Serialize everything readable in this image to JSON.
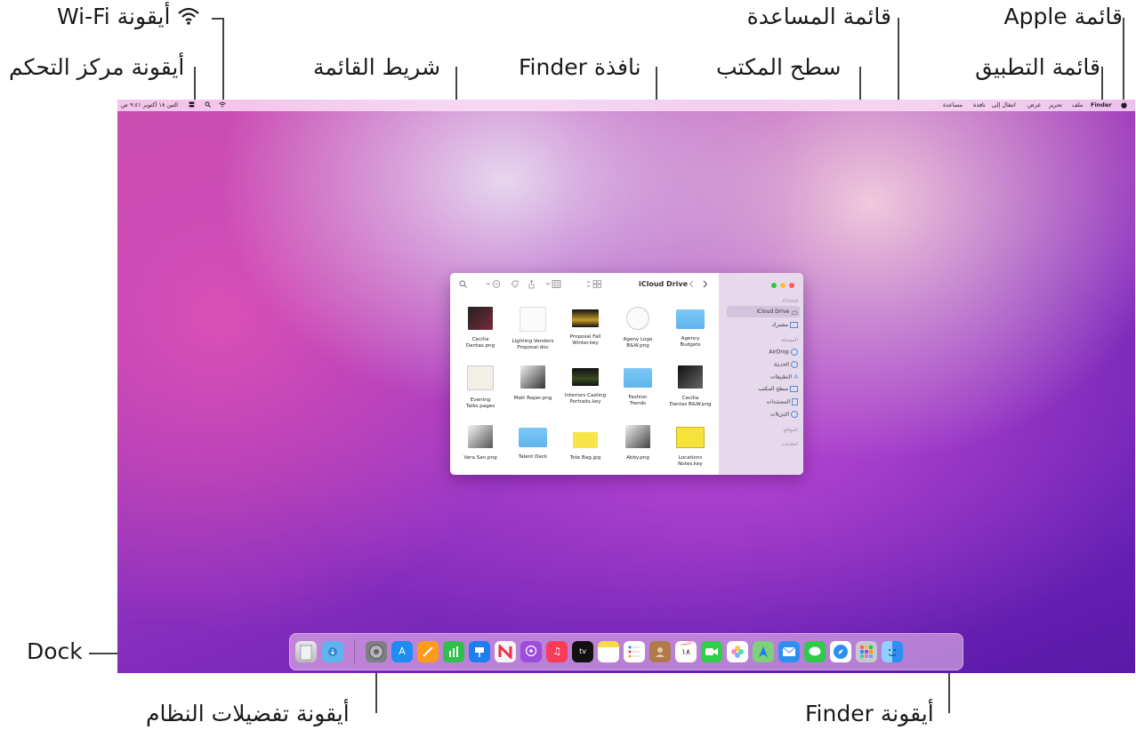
{
  "callouts": {
    "apple_menu": "قائمة Apple",
    "help_menu": "قائمة المساعدة",
    "wifi_icon": "أيقونة Wi-Fi",
    "control_center_icon": "أيقونة مركز التحكم",
    "menu_bar": "شريط القائمة",
    "finder_window": "نافذة Finder",
    "desktop": "سطح المكتب",
    "app_menu": "قائمة التطبيق",
    "dock": "Dock",
    "system_prefs_icon": "أيقونة تفضيلات النظام",
    "finder_icon": "أيقونة Finder"
  },
  "menubar": {
    "app_name": "Finder",
    "menus": [
      "ملف",
      "تحرير",
      "عرض",
      "انتقال إلى",
      "نافذة",
      "مساعدة"
    ],
    "clock": "الثين ١٨ أكتوبر ٩:٤١ ص"
  },
  "finder": {
    "title": "iCloud Drive",
    "sidebar": {
      "icloud_heading": "iCloud",
      "icloud_drive": "iCloud Drive",
      "shared": "مشترك",
      "favorites_heading": "المفضلة",
      "airdrop": "AirDrop",
      "recents": "الحديثة",
      "applications": "التطبيقات",
      "desktop": "سطح المكتب",
      "documents": "المستندات",
      "downloads": "التنزيلات",
      "locations_heading": "المواقع",
      "tags_heading": "العلامات"
    },
    "files": [
      {
        "line1": "Cecilia",
        "line2": "Dantas.png"
      },
      {
        "line1": "Lighting Vendors",
        "line2": "Proposal.doc"
      },
      {
        "line1": "Proposal Fall",
        "line2": "Winter.key"
      },
      {
        "line1": "Ageny Logo",
        "line2": "B&W.png"
      },
      {
        "line1": "Agency",
        "line2": "Budgets"
      },
      {
        "line1": "Evening",
        "line2": "Talks.pages"
      },
      {
        "line1": "Matt Roper.png",
        "line2": ""
      },
      {
        "line1": "Interiors Casting",
        "line2": "Portraits.key"
      },
      {
        "line1": "Fashion",
        "line2": "Trends"
      },
      {
        "line1": "Cecilia",
        "line2": "Dantas B&W.png"
      },
      {
        "line1": "Vera San.png",
        "line2": ""
      },
      {
        "line1": "Talent Deck",
        "line2": ""
      },
      {
        "line1": "Tote Bag.jpg",
        "line2": ""
      },
      {
        "line1": "Abby.png",
        "line2": ""
      },
      {
        "line1": "Locations",
        "line2": "Notes.key"
      }
    ]
  },
  "dock": {
    "calendar_month": "أكتوبر",
    "calendar_day": "١٨"
  },
  "colors": {
    "line": "#444444",
    "folder": "#5fb4ee",
    "traffic_red": "#ff5f57",
    "traffic_yellow": "#febc2e",
    "traffic_green": "#28c840"
  }
}
